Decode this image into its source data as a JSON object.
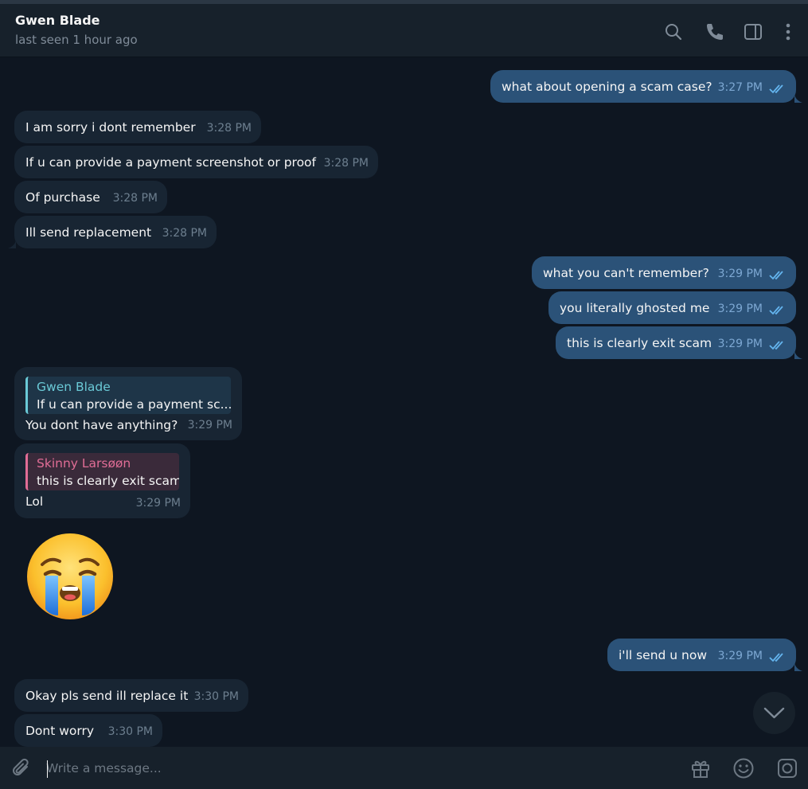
{
  "header": {
    "contact_name": "Gwen Blade",
    "status": "last seen 1 hour ago",
    "icons": [
      "search-icon",
      "phone-icon",
      "sidebar-toggle-icon",
      "more-vertical-icon"
    ]
  },
  "messages": [
    {
      "direction": "out",
      "text": "what about opening a scam case?",
      "time": "3:27 PM",
      "read": true
    },
    {
      "direction": "in",
      "text": "I am sorry i dont remember",
      "time": "3:28 PM"
    },
    {
      "direction": "in",
      "text": "If u can provide a payment screenshot or proof",
      "time": "3:28 PM"
    },
    {
      "direction": "in",
      "text": "Of purchase",
      "time": "3:28 PM"
    },
    {
      "direction": "in",
      "text": "Ill send replacement",
      "time": "3:28 PM"
    },
    {
      "direction": "out",
      "text": "what you can't remember?",
      "time": "3:29 PM",
      "read": true
    },
    {
      "direction": "out",
      "text": "you literally ghosted me",
      "time": "3:29 PM",
      "read": true
    },
    {
      "direction": "out",
      "text": "this is clearly exit scam",
      "time": "3:29 PM",
      "read": true
    },
    {
      "direction": "in",
      "reply_to": {
        "name": "Gwen Blade",
        "text": "If u can provide a payment sc..."
      },
      "text": "You dont have anything?",
      "time": "3:29 PM"
    },
    {
      "direction": "in",
      "reply_to": {
        "name": "Skinny Larsøøn",
        "text": "this is clearly exit scam"
      },
      "text": "Lol",
      "time": "3:29 PM"
    },
    {
      "direction": "in",
      "sticker": "loudly-crying-face-emoji"
    },
    {
      "direction": "out",
      "text": "i'll send u now",
      "time": "3:29 PM",
      "read": true
    },
    {
      "direction": "in",
      "text": "Okay pls send ill replace it",
      "time": "3:30 PM"
    },
    {
      "direction": "in",
      "text": "Dont worry",
      "time": "3:30 PM"
    }
  ],
  "composer": {
    "placeholder": "Write a message...",
    "icons": [
      "attach-icon",
      "gift-icon",
      "emoji-icon",
      "camera-icon"
    ]
  },
  "colors": {
    "background": "#0e1621",
    "header": "#17212b",
    "incoming_bubble": "#182533",
    "outgoing_bubble": "#2b5278",
    "reply_accent_blue": "#6ac9d6",
    "reply_accent_pink": "#e06d96",
    "read_ticks": "#64b5ef"
  }
}
